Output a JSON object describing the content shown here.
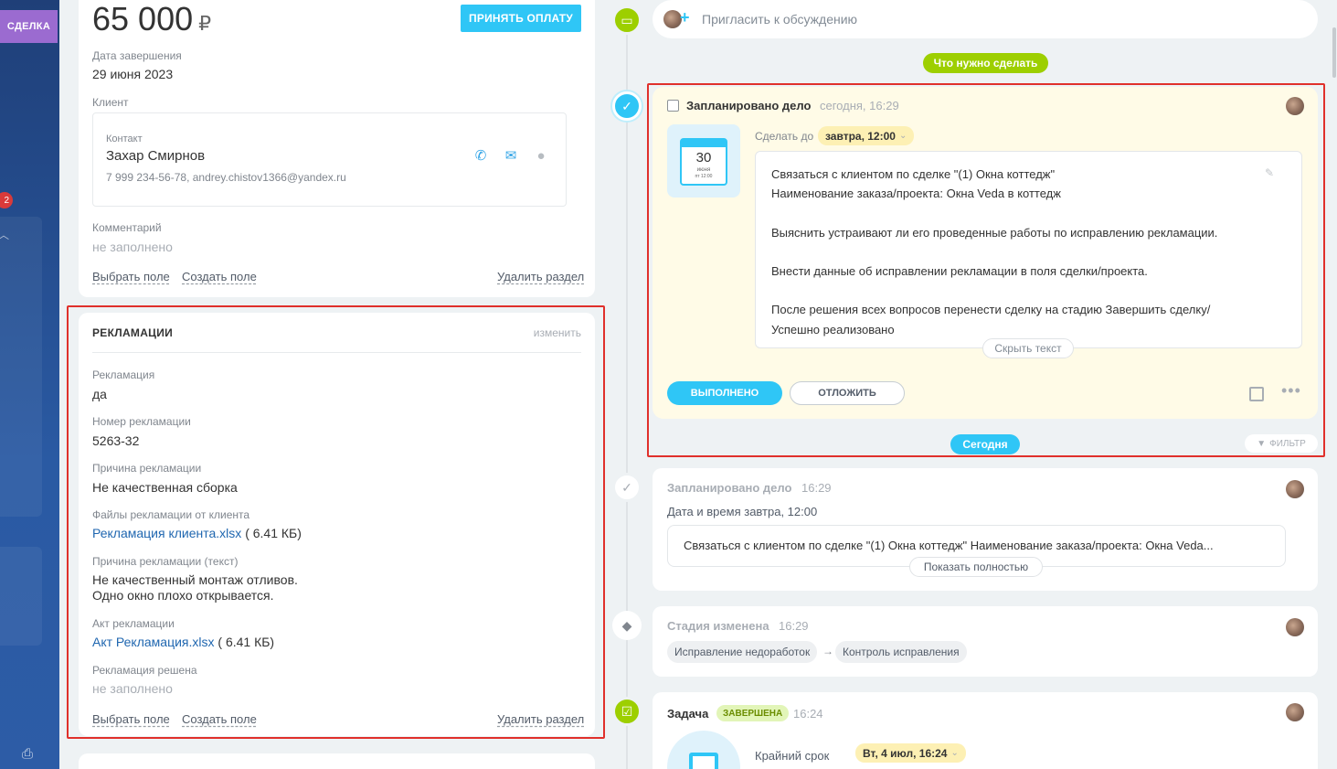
{
  "rail": {
    "tag": "СДЕЛКА",
    "badge": "2"
  },
  "deal": {
    "amount": "65 000",
    "currency": "₽",
    "pay_button": "ПРИНЯТЬ ОПЛАТУ",
    "close_date_label": "Дата завершения",
    "close_date": "29 июня 2023",
    "client_label": "Клиент",
    "contact_label": "Контакт",
    "contact_name": "Захар Смирнов",
    "contact_details": "7 999 234-56-78, andrey.chistov1366@yandex.ru",
    "comment_label": "Комментарий",
    "comment_value": "не заполнено",
    "choose_field": "Выбрать поле",
    "create_field": "Создать поле",
    "delete_section": "Удалить раздел"
  },
  "claims": {
    "title": "РЕКЛАМАЦИИ",
    "edit": "изменить",
    "fields": {
      "claim_label": "Рекламация",
      "claim_value": "да",
      "number_label": "Номер рекламации",
      "number_value": "5263-32",
      "reason_label": "Причина рекламации",
      "reason_value": "Не качественная сборка",
      "files_label": "Файлы рекламации от клиента",
      "files_link": "Рекламация клиента.xlsx",
      "files_size": "( 6.41 КБ)",
      "reason_text_label": "Причина рекламации (текст)",
      "reason_text_line1": "Не качественный монтаж отливов.",
      "reason_text_line2": "Одно окно плохо открывается.",
      "act_label": "Акт рекламации",
      "act_link": "Акт Рекламация.xlsx",
      "act_size": "( 6.41 КБ)",
      "resolved_label": "Рекламация решена",
      "resolved_value": "не заполнено"
    },
    "choose_field": "Выбрать поле",
    "create_field": "Создать поле",
    "delete_section": "Удалить раздел"
  },
  "timeline": {
    "invite": "Пригласить к обсуждению",
    "todo_pill": "Что нужно сделать",
    "today_pill": "Сегодня",
    "filter": "ФИЛЬТР",
    "activity": {
      "title": "Запланировано дело",
      "time": "сегодня, 16:29",
      "cal_day": "30",
      "cal_month": "июня",
      "cal_dow": "пт 12:00",
      "due_label": "Сделать до",
      "due_value": "завтра, 12:00",
      "description": "Связаться с клиентом по сделке \"(1) Окна коттедж\"\nНаименование заказа/проекта: Окна Veda в коттедж\n\nВыяснить устраивают ли его проведенные работы по исправлению рекламации.\n\nВнести данные об исправлении рекламации в поля сделки/проекта.\n\nПосле решения всех вопросов перенести сделку на стадию Завершить сделку/\nУспешно реализовано",
      "hide_text": "Скрыть текст",
      "done_button": "ВЫПОЛНЕНО",
      "later_button": "ОТЛОЖИТЬ"
    },
    "event1": {
      "title": "Запланировано дело",
      "time": "16:29",
      "sub": "Дата и время завтра, 12:00",
      "text": "Связаться с клиентом по сделке \"(1) Окна коттедж\" Наименование заказа/проекта: Окна Veda...",
      "show_full": "Показать полностью"
    },
    "event2": {
      "title": "Стадия изменена",
      "time": "16:29",
      "from": "Исправление недоработок",
      "arrow": "→",
      "to": "Контроль исправления"
    },
    "event3": {
      "title": "Задача",
      "badge": "ЗАВЕРШЕНА",
      "time": "16:24",
      "deadline_label": "Крайний срок",
      "deadline_value": "Вт, 4 июл, 16:24"
    }
  },
  "colors": {
    "accent": "#2fc6f6",
    "green": "#9dcf00",
    "frame": "#e0302b",
    "link": "#2067b0"
  }
}
